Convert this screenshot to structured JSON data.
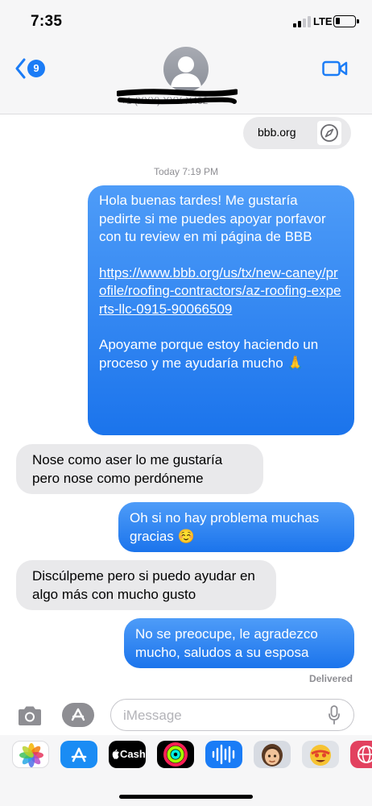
{
  "status_bar": {
    "time": "7:35",
    "network": "LTE"
  },
  "header": {
    "back_count": "9",
    "contact_name": "+1 (XXX) XXX-X432"
  },
  "link_preview": {
    "domain": "bbb.org"
  },
  "conversation": {
    "timestamp": "Today 7:19 PM",
    "msg1": {
      "p1": "Hola buenas tardes! Me gustaría pedirte si me puedes apoyar porfavor con tu review en mi página de BBB",
      "link": "https://www.bbb.org/us/tx/new-caney/profile/roofing-contractors/az-roofing-experts-llc-0915-90066509",
      "p2": "Apoyame porque estoy haciendo un proceso y me ayudaría mucho 🙏"
    },
    "msg2": "Nose como aser lo  me gustaría pero nose como perdóneme",
    "msg3": "Oh si no hay problema muchas gracias ☺️",
    "msg4": "Discúlpeme pero si puedo ayudar en algo más con mucho gusto",
    "msg5": "No se preocupe, le agradezco mucho, saludos a su esposa",
    "delivered": "Delivered"
  },
  "compose": {
    "placeholder": "iMessage"
  },
  "drawer": {
    "cash_label": "Cash",
    "apps": [
      "photos-icon",
      "app-store-icon",
      "apple-cash-icon",
      "activity-icon",
      "audio-message-icon",
      "memoji-icon",
      "animoji-icon",
      "globe-icon"
    ]
  },
  "colors": {
    "accent": "#1b7cf6",
    "outgoing": "#2f86f0",
    "incoming": "#e9e9eb",
    "header_bg": "#f6f6f7"
  }
}
